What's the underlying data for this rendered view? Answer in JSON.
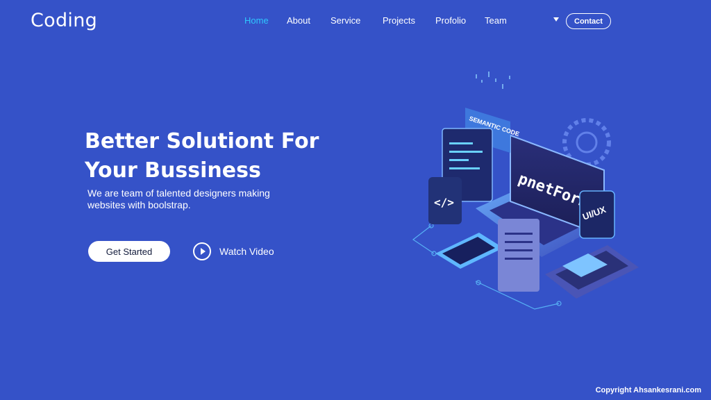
{
  "header": {
    "logo": "Coding",
    "nav": [
      {
        "label": "Home",
        "active": true
      },
      {
        "label": "About",
        "active": false
      },
      {
        "label": "Service",
        "active": false
      },
      {
        "label": "Projects",
        "active": false
      },
      {
        "label": "Profolio",
        "active": false
      },
      {
        "label": "Team",
        "active": false
      }
    ],
    "contact_label": "Contact"
  },
  "hero": {
    "title_line1": "Better Solutiont For",
    "title_line2": "Your Bussiness",
    "subtitle_line1": "We are team of talented designers making",
    "subtitle_line2": "websites with boolstrap.",
    "cta_label": "Get Started",
    "video_label": "Watch Video"
  },
  "illustration": {
    "screen_text": "pnetForm",
    "tag_semantic": "SEMANTIC CODE",
    "tag_uiux": "UI/UX",
    "tag_code": "</>"
  },
  "footer": {
    "copyright": "Copyright Ahsankesrani.com"
  },
  "colors": {
    "background": "#3552c8",
    "active_nav": "#2ec8ff",
    "button_text": "#111a3a"
  }
}
